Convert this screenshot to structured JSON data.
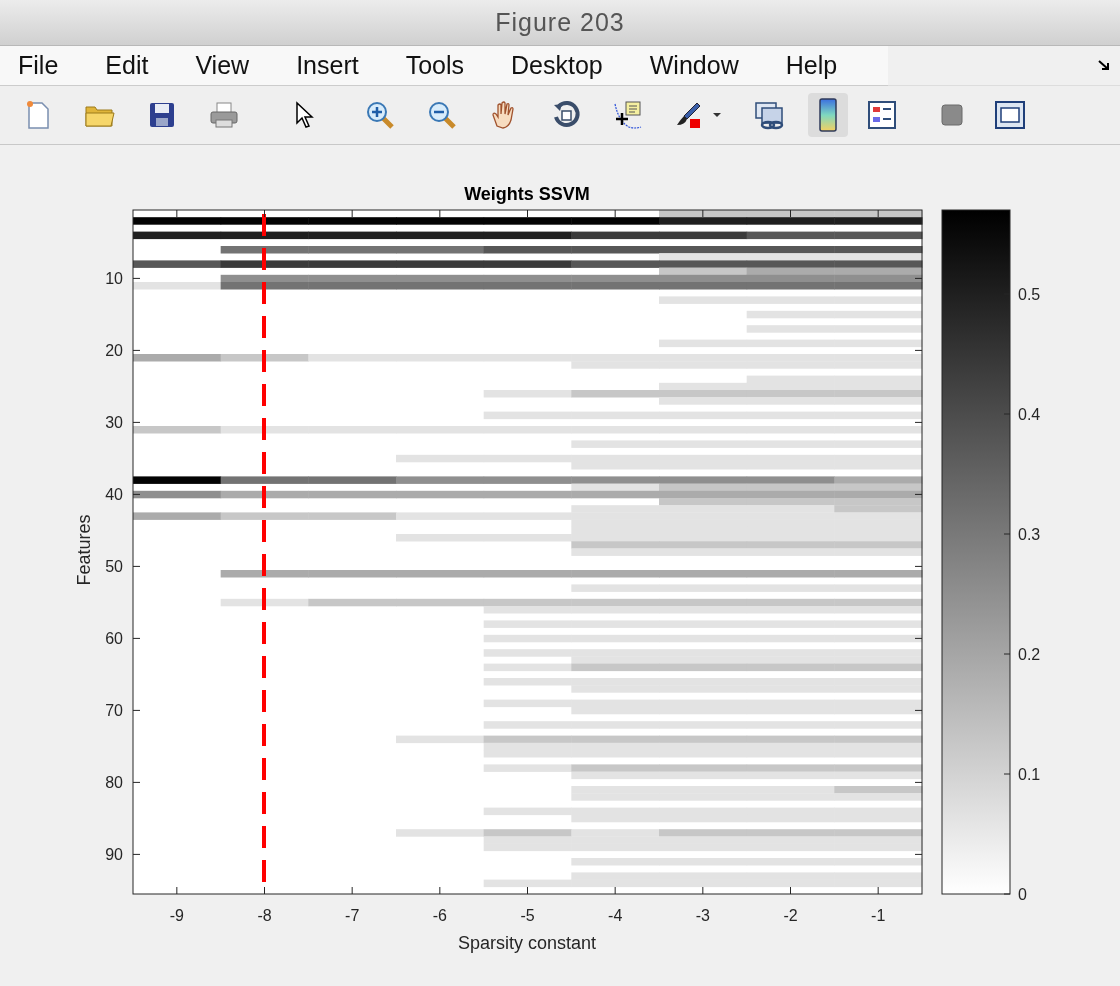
{
  "window": {
    "title": "Figure 203"
  },
  "menu": [
    "File",
    "Edit",
    "View",
    "Insert",
    "Tools",
    "Desktop",
    "Window",
    "Help"
  ],
  "toolbar": [
    {
      "kind": "new",
      "pressed": false
    },
    {
      "kind": "open",
      "pressed": false
    },
    {
      "kind": "save",
      "pressed": false
    },
    {
      "kind": "print",
      "pressed": false
    },
    {
      "kind": "pointer",
      "pressed": false
    },
    {
      "kind": "zoom-in",
      "pressed": false
    },
    {
      "kind": "zoom-out",
      "pressed": false
    },
    {
      "kind": "pan",
      "pressed": false
    },
    {
      "kind": "rotate",
      "pressed": false
    },
    {
      "kind": "datatip",
      "pressed": false
    },
    {
      "kind": "brush",
      "pressed": false
    },
    {
      "kind": "dropdown",
      "pressed": false
    },
    {
      "kind": "link",
      "pressed": false
    },
    {
      "kind": "colorbar",
      "pressed": true
    },
    {
      "kind": "legend",
      "pressed": false
    },
    {
      "kind": "hide",
      "pressed": false
    },
    {
      "kind": "plottools",
      "pressed": false
    }
  ],
  "plot": {
    "title": "Weights SSVM",
    "xlabel": "Sparsity constant",
    "ylabel": "Features",
    "xticks": [
      "-9",
      "-8",
      "-7",
      "-6",
      "-5",
      "-4",
      "-3",
      "-2",
      "-1"
    ],
    "yticks": [
      "10",
      "20",
      "30",
      "40",
      "50",
      "60",
      "70",
      "80",
      "90"
    ],
    "colorbar_ticks": [
      "0.5",
      "0.4",
      "0.3",
      "0.2",
      "0.1",
      "0"
    ]
  }
}
